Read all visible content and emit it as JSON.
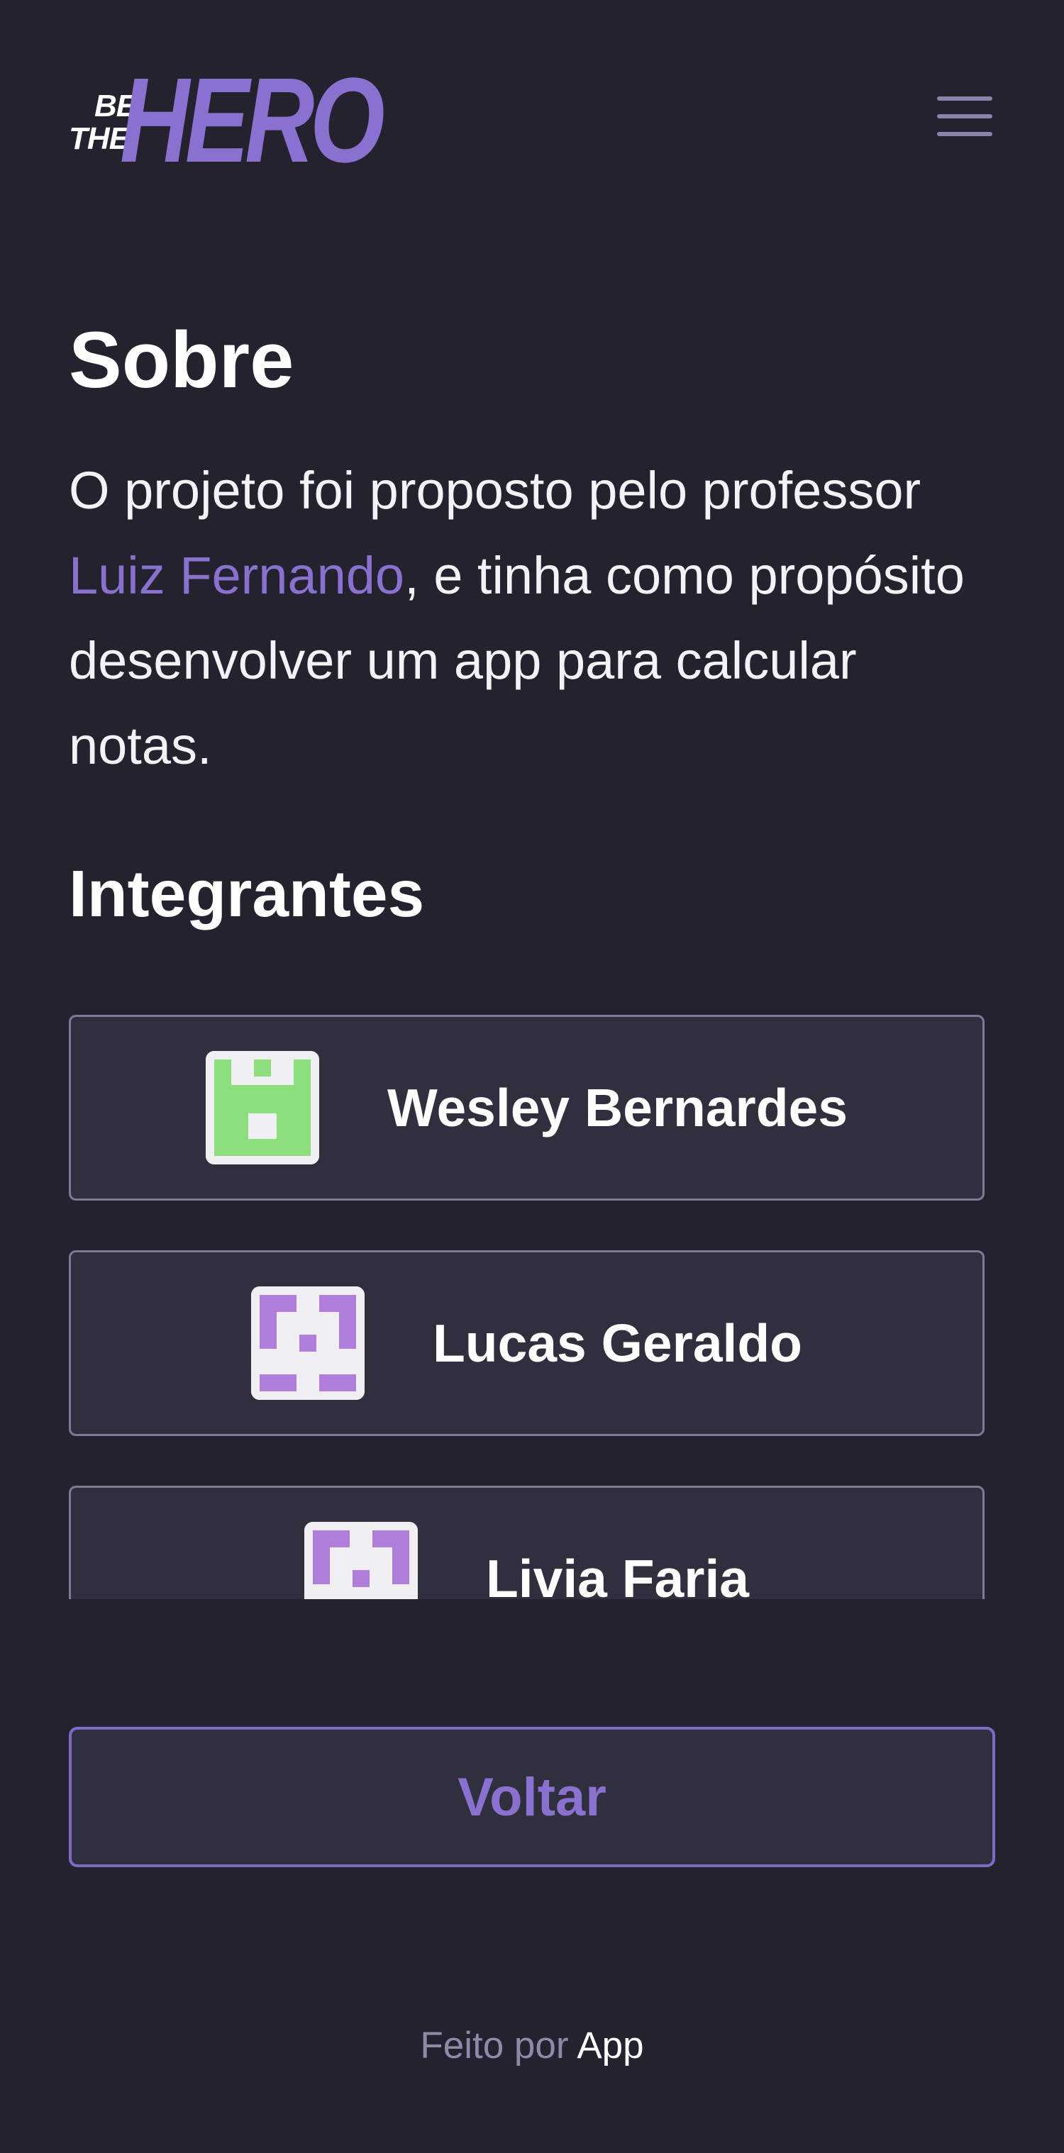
{
  "header": {
    "logo": {
      "be": "BE",
      "the": "THE",
      "hero": "HERO"
    },
    "menu_icon": "hamburger-menu-icon"
  },
  "main": {
    "title": "Sobre",
    "description": {
      "before_link": "O projeto foi proposto pelo professor ",
      "link_text": "Luiz Fernando",
      "after_link": ", e tinha como propósito desenvolver um app para calcular notas."
    },
    "section_title": "Integrantes",
    "members": [
      {
        "name": "Wesley Bernardes",
        "avatar_icon": "green-identicon"
      },
      {
        "name": "Lucas Geraldo",
        "avatar_icon": "purple-identicon"
      },
      {
        "name": "Livia Faria",
        "avatar_icon": "purple-identicon"
      }
    ],
    "back_button": "Voltar"
  },
  "footer": {
    "prefix": "Feito por ",
    "app": "App"
  },
  "colors": {
    "background": "#23222e",
    "card": "#302f3e",
    "accent": "#8a71d0",
    "muted": "#8f89aa",
    "green_avatar": "#8ddf7e",
    "purple_avatar": "#b07dd8"
  }
}
